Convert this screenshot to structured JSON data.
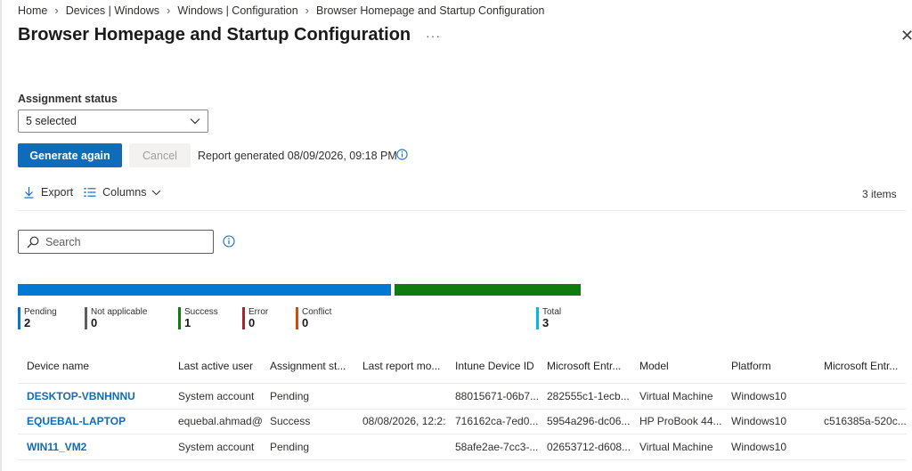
{
  "breadcrumb": [
    "Home",
    "Devices | Windows",
    "Windows | Configuration",
    "Browser Homepage and Startup Configuration"
  ],
  "page_title": "Browser Homepage and Startup Configuration",
  "more_label": "···",
  "close_label": "✕",
  "assignment_status": {
    "label": "Assignment status",
    "selected": "5 selected"
  },
  "buttons": {
    "generate": "Generate again",
    "cancel": "Cancel"
  },
  "report_generated": "Report generated 08/09/2026, 09:18 PM",
  "toolbar": {
    "export": "Export",
    "columns": "Columns",
    "items_count": "3 items"
  },
  "search": {
    "placeholder": "Search"
  },
  "status_bar": [
    {
      "status": "Pending",
      "fraction": 0.6667,
      "color": "#0078d4"
    },
    {
      "status": "Success",
      "fraction": 0.3333,
      "color": "#107c10"
    }
  ],
  "legend": [
    {
      "label": "Pending",
      "value": "2",
      "color": "#0078d4"
    },
    {
      "label": "Not applicable",
      "value": "0",
      "color": "#605e5c"
    },
    {
      "label": "Success",
      "value": "1",
      "color": "#107c10"
    },
    {
      "label": "Error",
      "value": "0",
      "color": "#a4262c"
    },
    {
      "label": "Conflict",
      "value": "0",
      "color": "#ca5010"
    },
    {
      "label": "Total",
      "value": "3",
      "color": "#00b7f1"
    }
  ],
  "table": {
    "columns": [
      "Device name",
      "Last active user",
      "Assignment st...",
      "Last report mo...",
      "Intune Device ID",
      "Microsoft Entr...",
      "Model",
      "Platform",
      "Microsoft Entr..."
    ],
    "rows": [
      [
        "DESKTOP-VBNHNNU",
        "System account",
        "Pending",
        "",
        "88015671-06b7...",
        "282555c1-1ecb...",
        "Virtual Machine",
        "Windows10",
        ""
      ],
      [
        "EQUEBAL-LAPTOP",
        "equebal.ahmad@",
        "Success",
        "08/08/2026, 12:2:",
        "716162ca-7ed0...",
        "5954a296-dc06...",
        "HP ProBook 44...",
        "Windows10",
        "c516385a-520c..."
      ],
      [
        "WIN11_VM2",
        "System account",
        "Pending",
        "",
        "58afe2ae-7cc3-...",
        "02653712-d608...",
        "Virtual Machine",
        "Windows10",
        ""
      ]
    ]
  }
}
